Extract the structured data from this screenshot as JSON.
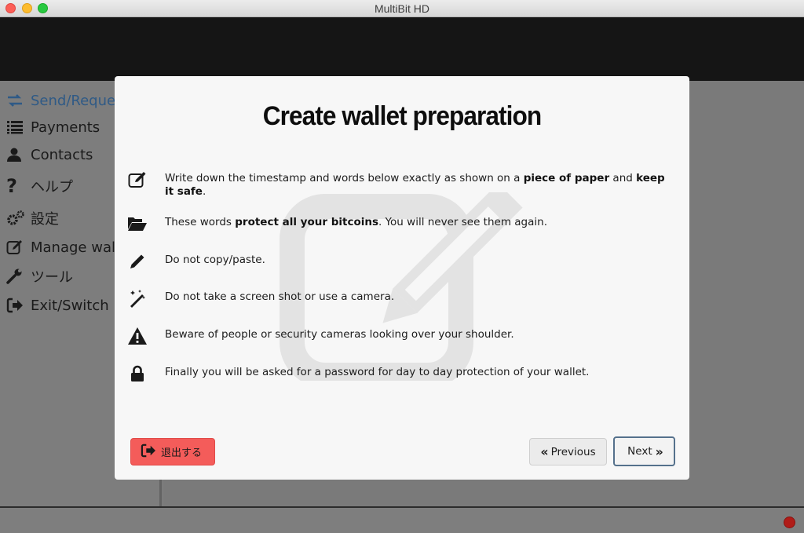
{
  "window": {
    "title": "MultiBit HD"
  },
  "sidebar": {
    "items": [
      {
        "label": "Send/Request",
        "icon": "arrows-exchange-icon"
      },
      {
        "label": "Payments",
        "icon": "list-icon"
      },
      {
        "label": "Contacts",
        "icon": "user-icon"
      },
      {
        "label": "ヘルプ",
        "icon": "question-icon"
      },
      {
        "label": "設定",
        "icon": "gears-icon"
      },
      {
        "label": "Manage wallet",
        "icon": "edit-icon"
      },
      {
        "label": "ツール",
        "icon": "wrench-icon"
      },
      {
        "label": "Exit/Switch",
        "icon": "sign-out-icon"
      }
    ]
  },
  "modal": {
    "title": "Create wallet preparation",
    "rows": [
      {
        "icon": "edit-icon",
        "pre": "Write down the timestamp and words below exactly as shown on a ",
        "b1": "piece of paper",
        "mid": " and ",
        "b2": "keep it safe",
        "post": "."
      },
      {
        "icon": "folder-open-icon",
        "pre": "These words ",
        "b1": "protect all your bitcoins",
        "post": ". You will never see them again."
      },
      {
        "icon": "pencil-icon",
        "text": "Do not copy/paste."
      },
      {
        "icon": "magic-wand-icon",
        "text": "Do not take a screen shot or use a camera."
      },
      {
        "icon": "warning-icon",
        "text": "Beware of people or security cameras looking over your shoulder."
      },
      {
        "icon": "lock-icon",
        "text": "Finally you will be asked for a password for day to day protection of your wallet."
      }
    ],
    "buttons": {
      "exit": "退出する",
      "previous": "Previous",
      "next": "Next"
    }
  },
  "status": {
    "indicator_color": "#b01c18"
  }
}
